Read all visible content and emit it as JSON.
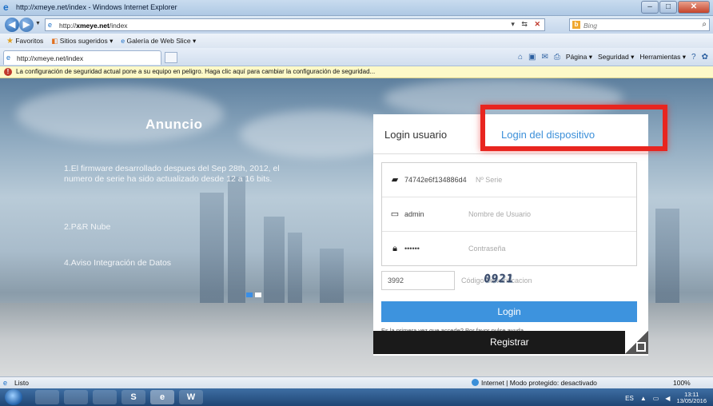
{
  "window": {
    "title": "http://xmeye.net/index - Windows Internet Explorer",
    "controls": {
      "minimize": "–",
      "maximize": "□",
      "close": "✕"
    }
  },
  "address": {
    "url_prefix": "http://",
    "url_domain": "xmeye.net",
    "url_path": "/index",
    "search_engine": "Bing",
    "search_placeholder": "Bing"
  },
  "favorites": {
    "favorites_label": "Favoritos",
    "suggested_label": "Sitios sugeridos ▾",
    "gallery_label": "Galería de Web Slice ▾"
  },
  "tabs": [
    {
      "label": "http://xmeye.net/index"
    }
  ],
  "command_bar": {
    "page": "Página ▾",
    "security": "Seguridad ▾",
    "tools": "Herramientas ▾"
  },
  "infobar": {
    "message": "La configuración de seguridad actual pone a su equipo en peligro. Haga clic aquí para cambiar la configuración de seguridad..."
  },
  "announcement": {
    "title": "Anuncio",
    "items": [
      "1.El firmware desarrollado despues del Sep 28th, 2012, el numero de serie ha sido actualizado desde 12 a 16 bits.",
      "2.P&R Nube",
      "4.Aviso Integración de Datos"
    ],
    "slides_total": 2,
    "slide_active": 1
  },
  "login": {
    "tab_user": "Login usuario",
    "tab_device": "Login del dispositivo",
    "serial_value": "74742e6f134886d4",
    "serial_hint": "Nº Serie",
    "user_value": "admin",
    "user_hint": "Nombre de Usuario",
    "password_value": "••••••",
    "password_hint": "Contraseña",
    "code_value": "3992",
    "code_hint": "Código de verificacion",
    "captcha_text": "0921",
    "login_button": "Login",
    "help_text": "Es la primera vez que accede? Por favor pulse ayuda",
    "register_button": "Registrar"
  },
  "status": {
    "left": "Listo",
    "middle": "Internet | Modo protegido: desactivado",
    "zoom": "100%"
  },
  "taskbar": {
    "apps": [
      "",
      "",
      "",
      "S",
      "e",
      "W"
    ],
    "language": "ES",
    "time": "13:11",
    "date": "13/05/2016"
  },
  "colors": {
    "accent_blue": "#3d93de",
    "highlight_red": "#e8251f",
    "register_bg": "#1a1a1a"
  }
}
